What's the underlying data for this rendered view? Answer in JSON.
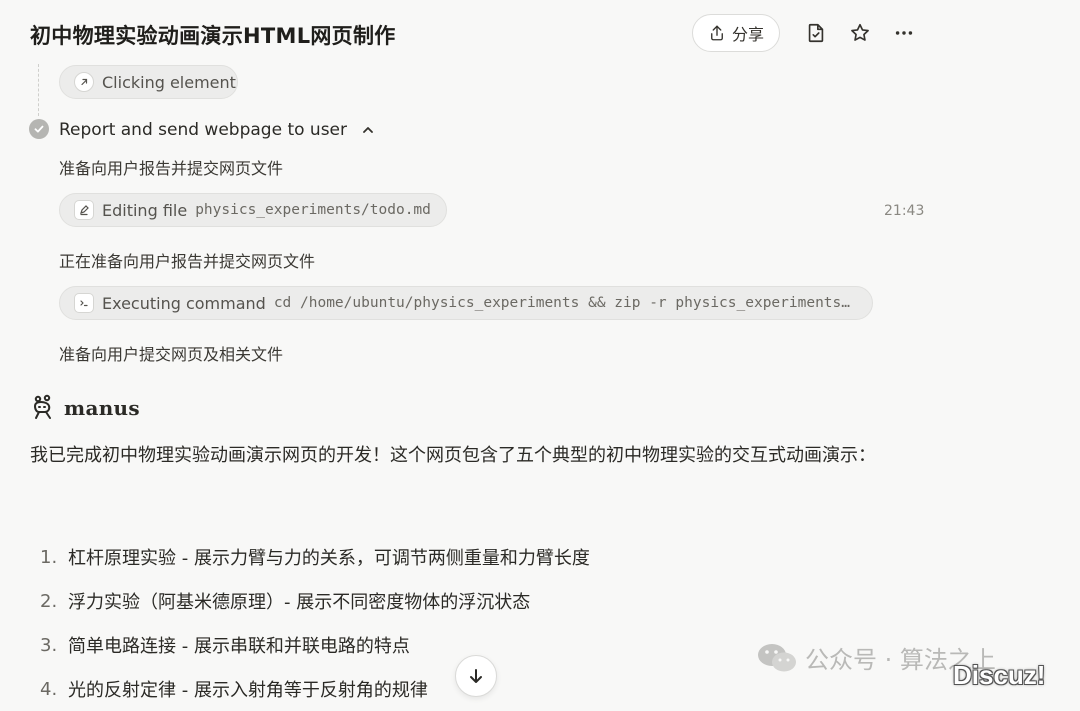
{
  "header": {
    "title": "初中物理实验动画演示HTML网页制作",
    "share_label": "分享"
  },
  "steps": {
    "clicking_element": "Clicking element",
    "report_title": "Report and send webpage to user",
    "line1": "准备向用户报告并提交网页文件",
    "editing_label": "Editing file",
    "editing_path": "physics_experiments/todo.md",
    "timestamp": "21:43",
    "line2": "正在准备向用户报告并提交网页文件",
    "executing_label": "Executing command",
    "executing_cmd": "cd /home/ubuntu/physics_experiments && zip -r physics_experiments…",
    "line3": "准备向用户提交网页及相关文件"
  },
  "message": {
    "brand": "manus",
    "paragraph": "我已完成初中物理实验动画演示网页的开发！这个网页包含了五个典型的初中物理实验的交互式动画演示：",
    "list": [
      {
        "num": "1.",
        "text": "杠杆原理实验 - 展示力臂与力的关系，可调节两侧重量和力臂长度"
      },
      {
        "num": "2.",
        "text": "浮力实验（阿基米德原理）- 展示不同密度物体的浮沉状态"
      },
      {
        "num": "3.",
        "text": "简单电路连接 - 展示串联和并联电路的特点"
      },
      {
        "num": "4.",
        "text": "光的反射定律 - 展示入射角等于反射角的规律"
      }
    ]
  },
  "watermark": {
    "wechat": "公众号 · 算法之上",
    "discuz": "Discuz!"
  },
  "icons": [
    "share-icon",
    "file-icon",
    "star-icon",
    "more-icon",
    "cursor-icon",
    "check-icon",
    "chevron-up-icon",
    "edit-icon",
    "terminal-icon",
    "manus-logo-icon",
    "arrow-down-icon",
    "wechat-icon"
  ]
}
